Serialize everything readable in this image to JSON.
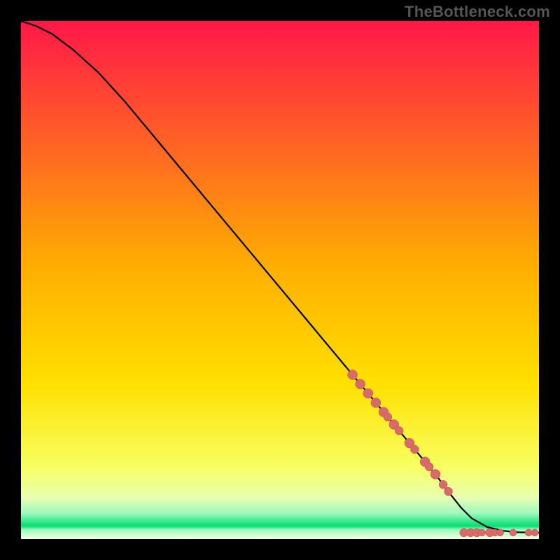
{
  "watermark": "TheBottleneck.com",
  "colors": {
    "gradient_top": "#ff1848",
    "gradient_mid": "#ffd000",
    "gradient_low": "#f8ff60",
    "gradient_band_pale": "#d8ffb0",
    "gradient_band_green": "#00e070",
    "background": "#000000",
    "curve": "#000000",
    "marker_fill": "#d86a6a",
    "marker_stroke": "#c84f4f"
  },
  "chart_data": {
    "type": "line",
    "title": "",
    "xlabel": "",
    "ylabel": "",
    "xlim": [
      0,
      100
    ],
    "ylim": [
      0,
      100
    ],
    "grid": false,
    "legend": false,
    "curve": {
      "x": [
        0,
        3,
        6,
        10,
        15,
        20,
        25,
        30,
        35,
        40,
        45,
        50,
        55,
        60,
        65,
        70,
        75,
        80,
        83,
        85,
        87,
        90,
        93,
        96,
        100
      ],
      "y": [
        100,
        99,
        97.5,
        94.5,
        90,
        84.5,
        78.5,
        72.5,
        66.5,
        60.5,
        54.5,
        48.5,
        42.5,
        36.5,
        30.5,
        24.5,
        18.5,
        12.5,
        8.5,
        6,
        4,
        2.3,
        1.6,
        1.3,
        1.2
      ]
    },
    "markers_on_curve": {
      "x": [
        64,
        65.5,
        67,
        68.5,
        70,
        70.8,
        72,
        73,
        75,
        76,
        78,
        78.8,
        80,
        81.5,
        82.5
      ],
      "r": [
        7,
        7,
        7,
        7,
        7,
        6,
        7,
        6,
        7,
        6,
        7,
        6,
        7,
        6,
        6
      ]
    },
    "markers_on_floor": {
      "x": [
        85.5,
        86.8,
        88,
        89,
        90.5,
        91.5,
        92.5,
        95,
        98,
        99.2
      ],
      "r": [
        6,
        6,
        6,
        5,
        6,
        5,
        5,
        5,
        5,
        5
      ]
    }
  }
}
